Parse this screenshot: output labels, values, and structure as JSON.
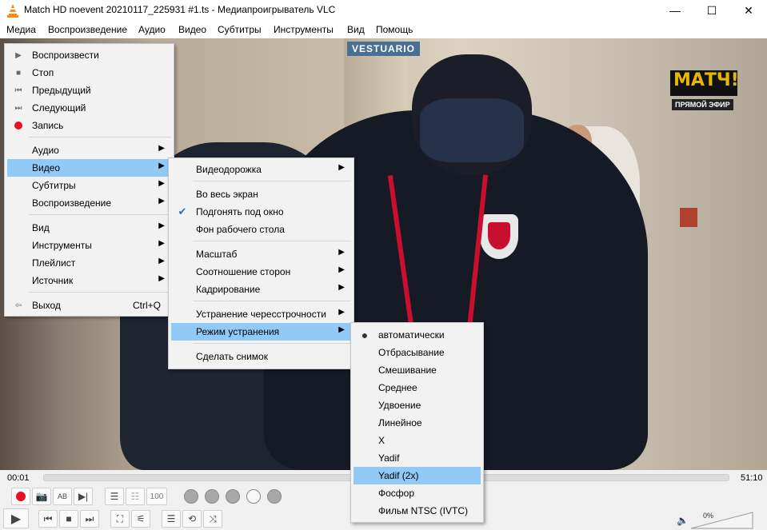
{
  "window": {
    "title": "Match HD noevent 20210117_225931 #1.ts - Медиапроигрыватель VLC",
    "minimize": "—",
    "maximize": "☐",
    "close": "✕"
  },
  "menubar": [
    "Медиа",
    "Воспроизведение",
    "Аудио",
    "Видео",
    "Субтитры",
    "Инструменты",
    "Вид",
    "Помощь"
  ],
  "video_overlay": {
    "channel_logo": "МАТЧ!",
    "live_label": "ПРЯМОЙ ЭФИР",
    "sign": "VESTUARIO"
  },
  "media_menu": {
    "items": [
      {
        "label": "Воспроизвести",
        "icon": "play-icon"
      },
      {
        "label": "Стоп",
        "icon": "stop-icon"
      },
      {
        "label": "Предыдущий",
        "icon": "previous-icon"
      },
      {
        "label": "Следующий",
        "icon": "next-icon"
      },
      {
        "label": "Запись",
        "icon": "record-icon"
      },
      {
        "label": "Аудио",
        "submenu": true
      },
      {
        "label": "Видео",
        "submenu": true,
        "highlighted": true
      },
      {
        "label": "Субтитры",
        "submenu": true
      },
      {
        "label": "Воспроизведение",
        "submenu": true
      },
      {
        "label": "Вид",
        "submenu": true
      },
      {
        "label": "Инструменты",
        "submenu": true
      },
      {
        "label": "Плейлист",
        "submenu": true
      },
      {
        "label": "Источник",
        "submenu": true
      },
      {
        "label": "Выход",
        "shortcut": "Ctrl+Q",
        "icon": "exit-icon"
      }
    ]
  },
  "video_menu": {
    "items": [
      {
        "label": "Видеодорожка",
        "submenu": true
      },
      {
        "label": "Во весь экран"
      },
      {
        "label": "Подгонять под окно",
        "checked": true
      },
      {
        "label": "Фон рабочего стола"
      },
      {
        "label": "Масштаб",
        "submenu": true
      },
      {
        "label": "Соотношение сторон",
        "submenu": true
      },
      {
        "label": "Кадрирование",
        "submenu": true
      },
      {
        "label": "Устранение чересстрочности",
        "submenu": true
      },
      {
        "label": "Режим устранения",
        "submenu": true,
        "highlighted": true
      },
      {
        "label": "Сделать снимок"
      }
    ]
  },
  "deinterlace_menu": {
    "items": [
      {
        "label": "автоматически",
        "selected": true
      },
      {
        "label": "Отбрасывание"
      },
      {
        "label": "Смешивание"
      },
      {
        "label": "Среднее"
      },
      {
        "label": "Удвоение"
      },
      {
        "label": "Линейное"
      },
      {
        "label": "X"
      },
      {
        "label": "Yadif"
      },
      {
        "label": "Yadif (2x)",
        "highlighted": true
      },
      {
        "label": "Фосфор"
      },
      {
        "label": "Фильм NTSC (IVTC)"
      }
    ]
  },
  "seekbar": {
    "elapsed": "00:01",
    "total": "51:10",
    "progress_fraction": 0.0
  },
  "controls": {
    "speed_value": "100",
    "volume": "0%"
  },
  "colors": {
    "highlight": "#91c9f7",
    "menu_bg": "#f2f2f2",
    "record_red": "#e81123"
  }
}
